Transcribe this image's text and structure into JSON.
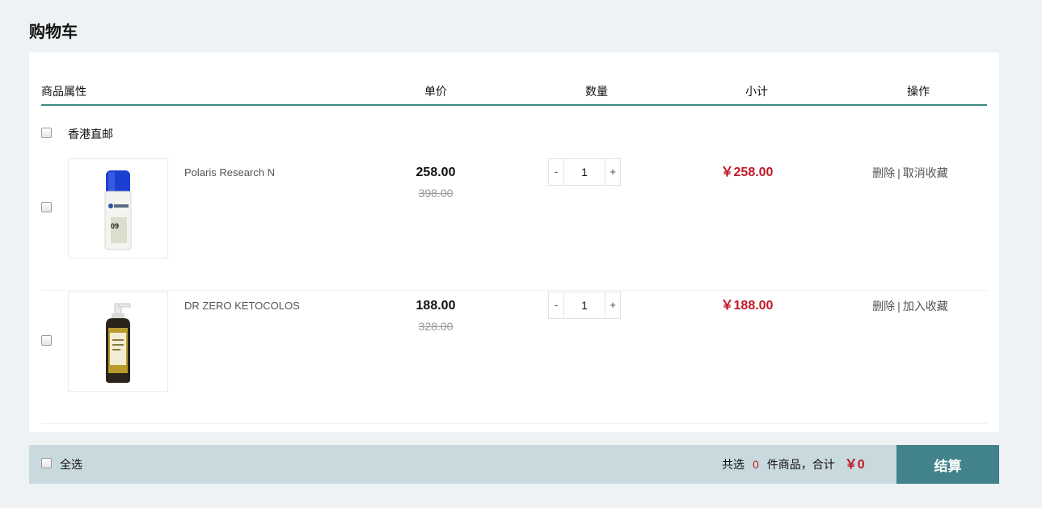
{
  "page": {
    "title": "购物车"
  },
  "header": {
    "columns": [
      "商品属性",
      "单价",
      "数量",
      "小计",
      "操作"
    ]
  },
  "store": {
    "name": "香港直邮",
    "checked": false
  },
  "items": [
    {
      "name": "Polaris Research N",
      "image_icon": "spray-bottle-image",
      "price": "258.00",
      "original_price": "398.00",
      "quantity": "1",
      "minus_label": "-",
      "plus_label": "+",
      "subtotal": "￥258.00",
      "op_delete": "删除",
      "op_separator": "|",
      "op_favorite": "取消收藏",
      "checked": false
    },
    {
      "name": "DR ZERO KETOCOLOS",
      "image_icon": "pump-bottle-image",
      "price": "188.00",
      "original_price": "328.00",
      "quantity": "1",
      "minus_label": "-",
      "plus_label": "+",
      "subtotal": "￥188.00",
      "op_delete": "删除",
      "op_separator": "|",
      "op_favorite": "加入收藏",
      "checked": false
    }
  ],
  "footer": {
    "select_all_label": "全选",
    "selected_prefix": "共选",
    "selected_count": "0",
    "selected_suffix": "件商品，合计",
    "total": "￥0",
    "checkout_label": "结算"
  },
  "colors": {
    "accent": "#42828b",
    "price_red": "#c0182a",
    "header_line": "#3d8a84",
    "footer_bg": "#c9dade",
    "page_bg": "#eef2f4"
  }
}
